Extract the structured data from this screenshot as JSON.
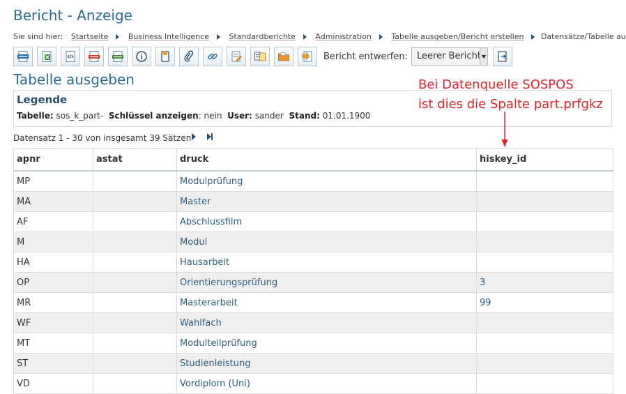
{
  "header": {
    "title": "Bericht - Anzeige"
  },
  "breadcrumb": {
    "prefix": "Sie sind hier:",
    "items": [
      "Startseite",
      "Business Intelligence",
      "Standardberichte",
      "Administration",
      "Tabelle ausgeben/Bericht erstellen"
    ],
    "current": "Datensätze/Tabelle ausgeben"
  },
  "toolbar": {
    "buttons": [
      "html-export-icon",
      "excel-export-icon",
      "xml-export-icon",
      "pdf-export-icon",
      "csv-export-icon",
      "info-icon",
      "bookmark-icon",
      "attachment-icon",
      "link-icon",
      "edit-report-icon",
      "compare-icon",
      "folder-icon",
      "export-arrow-icon"
    ],
    "bericht_label": "Bericht entwerfen:",
    "select_value": "Leerer Bericht"
  },
  "section": {
    "title": "Tabelle ausgeben"
  },
  "legend": {
    "title": "Legende",
    "tabelle_label": "Tabelle:",
    "tabelle_value": "sos_k_part-",
    "schluessel_label": "Schlüssel anzeigen",
    "schluessel_value": ": nein",
    "user_label": "User:",
    "user_value": "sander",
    "stand_label": "Stand:",
    "stand_value": "01.01.1900"
  },
  "annotation": {
    "line1": "Bei Datenquelle SOSPOS",
    "line2": "ist dies die Spalte part.prfgkz",
    "color": "#e0262a"
  },
  "pager": {
    "text": "Datensatz 1 - 30 von insgesamt 39 Sätzen"
  },
  "table": {
    "columns": [
      "apnr",
      "astat",
      "druck",
      "hiskey_id"
    ],
    "rows": [
      [
        "MP",
        "",
        "Modulprüfung",
        ""
      ],
      [
        "MA",
        "",
        "Master",
        ""
      ],
      [
        "AF",
        "",
        "Abschlussfilm",
        ""
      ],
      [
        "M",
        "",
        "Modul",
        ""
      ],
      [
        "HA",
        "",
        "Hausarbeit",
        ""
      ],
      [
        "OP",
        "",
        "Orientierungsprüfung",
        "3"
      ],
      [
        "MR",
        "",
        "Masterarbeit",
        "99"
      ],
      [
        "WF",
        "",
        "Wahlfach",
        ""
      ],
      [
        "MT",
        "",
        "Modulteilprüfung",
        ""
      ],
      [
        "ST",
        "",
        "Studienleistung",
        ""
      ],
      [
        "VD",
        "",
        "Vordiplom (Uni)",
        ""
      ]
    ]
  },
  "colors": {
    "title": "#2b6a8f",
    "link": "#2b5d80",
    "row_alt": "#efefef"
  }
}
